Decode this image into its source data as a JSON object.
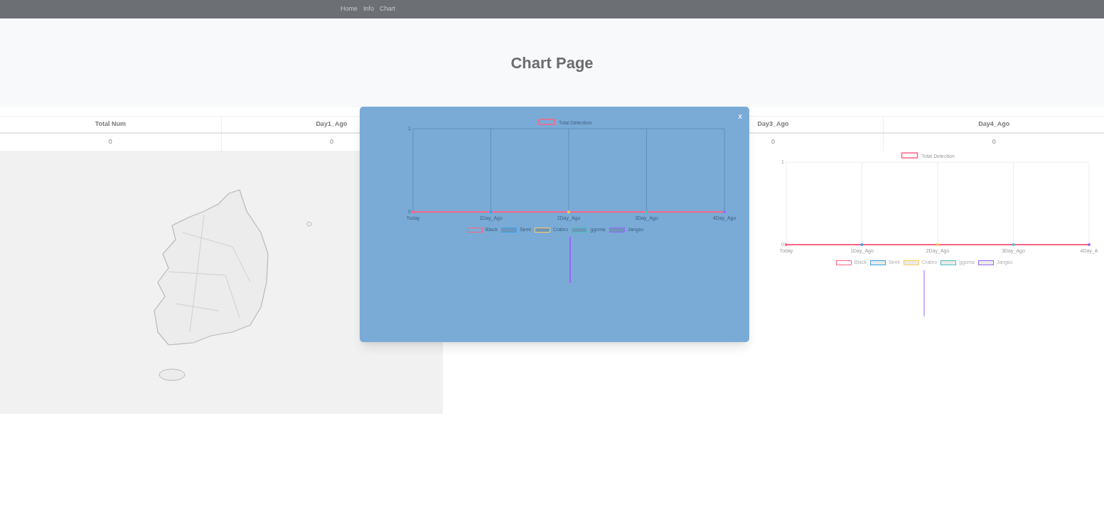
{
  "nav": {
    "links": [
      {
        "label": "Home"
      },
      {
        "label": "Info"
      },
      {
        "label": "Chart"
      }
    ]
  },
  "header": {
    "title": "Chart Page"
  },
  "table": {
    "left_columns": [
      "Total Num",
      "Day1_Ago"
    ],
    "right_columns": [
      "Day3_Ago",
      "Day4_Ago"
    ],
    "left_cells": [
      "0",
      "0"
    ],
    "right_cells": [
      "0",
      "0"
    ]
  },
  "page_chart": {
    "chart_data": {
      "type": "line",
      "categories": [
        "Today",
        "1Day_Ago",
        "2Day_Ago",
        "3Day_Ago",
        "4Day_A"
      ],
      "series": [
        {
          "name": "Total Detection",
          "color": "#ff6384",
          "values": [
            0,
            0,
            0,
            0,
            0
          ]
        }
      ],
      "ylim": [
        0,
        1
      ],
      "yticks": [
        0,
        1
      ],
      "grid": true
    },
    "legend": [
      {
        "label": "Black",
        "color": "#ff6384"
      },
      {
        "label": "Semi",
        "color": "#36a2eb"
      },
      {
        "label": "Crabro",
        "color": "#ffcd56"
      },
      {
        "label": "ggoma",
        "color": "#4bc0c0"
      },
      {
        "label": "Jangsu",
        "color": "#9966ff"
      }
    ]
  },
  "modal": {
    "close": "x",
    "chart_data": {
      "type": "line",
      "categories": [
        "Today",
        "1Day_Ago",
        "2Day_Ago",
        "3Day_Ago",
        "4Day_Ago"
      ],
      "series": [
        {
          "name": "Total Detection",
          "color": "#ff6384",
          "values": [
            0,
            0,
            0,
            0,
            0
          ]
        }
      ],
      "ylim": [
        0,
        1
      ],
      "yticks": [
        0,
        1
      ],
      "grid": true
    },
    "legend": [
      {
        "label": "Black",
        "color": "#ff6384"
      },
      {
        "label": "Semi",
        "color": "#36a2eb"
      },
      {
        "label": "Crabro",
        "color": "#ffcd56"
      },
      {
        "label": "ggoma",
        "color": "#4bc0c0"
      },
      {
        "label": "Jangsu",
        "color": "#9966ff"
      }
    ]
  }
}
